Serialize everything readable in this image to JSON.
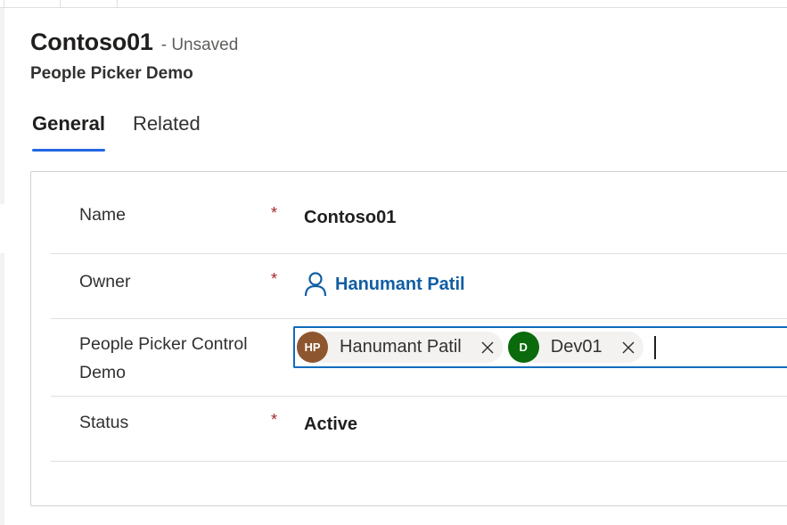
{
  "record": {
    "name": "Contoso01",
    "status": "- Unsaved",
    "entity": "People Picker Demo"
  },
  "tabs": [
    {
      "label": "General",
      "active": true
    },
    {
      "label": "Related",
      "active": false
    }
  ],
  "fields": {
    "name": {
      "label": "Name",
      "required": "*",
      "value": "Contoso01"
    },
    "owner": {
      "label": "Owner",
      "required": "*",
      "value": "Hanumant Patil",
      "icon": "person-icon"
    },
    "people_picker": {
      "label_line1": "People Picker Control",
      "label_line2": "Demo",
      "selected": [
        {
          "initials": "HP",
          "name": "Hanumant Patil",
          "color": "#8e562e"
        },
        {
          "initials": "D",
          "name": "Dev01",
          "color": "#0b6a0b"
        }
      ]
    },
    "status": {
      "label": "Status",
      "required": "*",
      "value": "Active"
    }
  },
  "colors": {
    "accent": "#2266e3",
    "link": "#115ea3",
    "required": "#a4262c",
    "focus_border": "#0f6cbd"
  }
}
